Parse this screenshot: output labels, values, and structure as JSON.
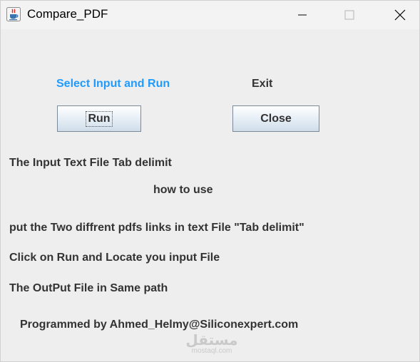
{
  "window": {
    "title": "Compare_PDF",
    "icon": "java-coffee-cup-icon"
  },
  "controls": {
    "minimize_icon": "minimize-icon",
    "maximize_icon": "maximize-icon",
    "close_icon": "close-icon"
  },
  "main": {
    "select_label": "Select Input and Run",
    "exit_label": "Exit",
    "run_button": "Run",
    "close_button": "Close",
    "input_info": "The Input Text File Tab delimit",
    "how_to_use": "how to use",
    "instruction_1": "put the Two diffrent pdfs links in text File \"Tab delimit\"",
    "instruction_2": "Click on Run and Locate you input File",
    "instruction_3": "The OutPut File in Same path",
    "credit": "Programmed by Ahmed_Helmy@Siliconexpert.com"
  },
  "watermark": {
    "text": "مستقل",
    "subtext": "mostaql.com"
  },
  "colors": {
    "accent_label": "#1e9bff",
    "text": "#333333",
    "background": "#eeeeee"
  }
}
